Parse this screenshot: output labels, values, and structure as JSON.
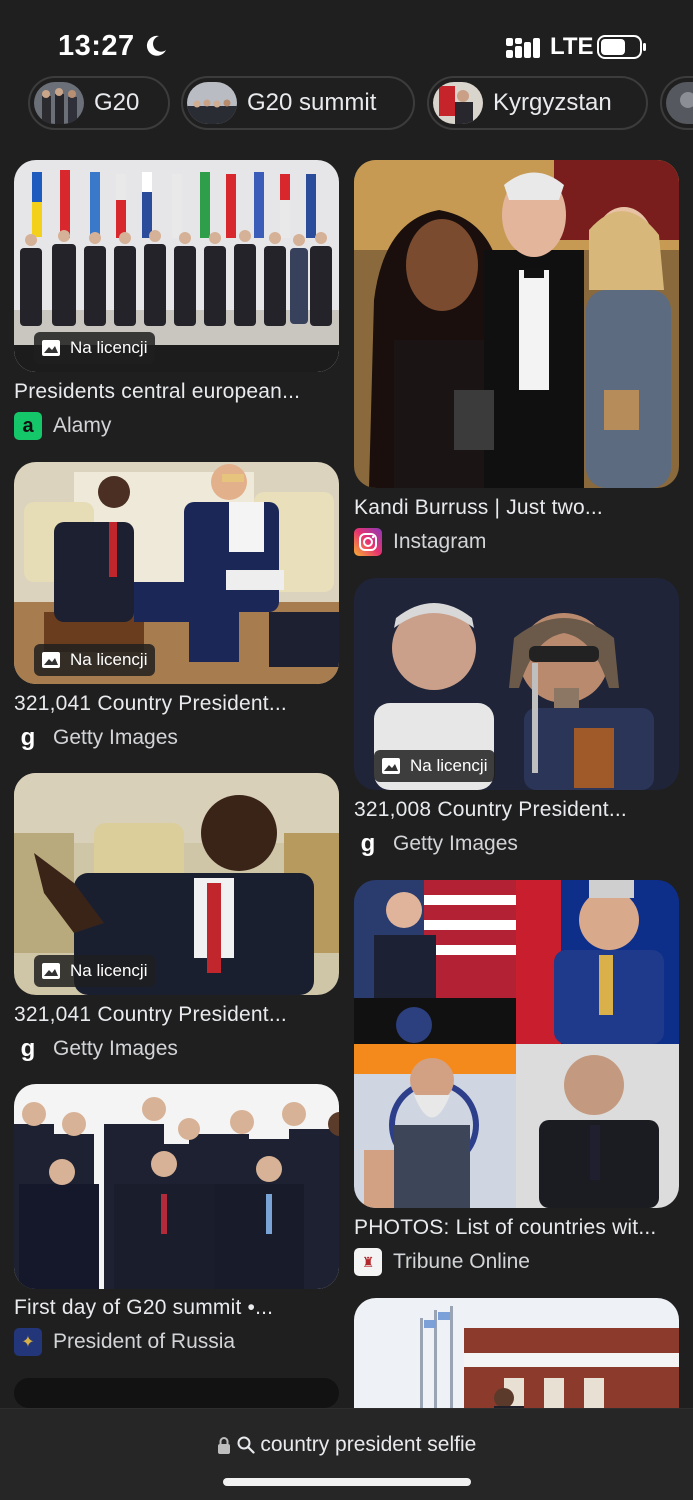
{
  "status_bar": {
    "time": "13:27",
    "network": "LTE"
  },
  "chips": [
    {
      "label": "G20"
    },
    {
      "label": "G20 summit"
    },
    {
      "label": "Kyrgyzstan"
    }
  ],
  "results_left": [
    {
      "title": "Presidents central european...",
      "source": "Alamy",
      "badge": "Na licencji"
    },
    {
      "title": "321,041 Country President...",
      "source": "Getty Images",
      "badge": "Na licencji"
    },
    {
      "title": "321,041 Country President...",
      "source": "Getty Images",
      "badge": "Na licencji"
    },
    {
      "title": "First day of G20 summit •...",
      "source": "President of Russia"
    }
  ],
  "results_right": [
    {
      "title": "Kandi Burruss | Just two...",
      "source": "Instagram"
    },
    {
      "title": "321,008 Country President...",
      "source": "Getty Images",
      "badge": "Na licencji"
    },
    {
      "title": "PHOTOS: List of countries wit...",
      "source": "Tribune Online"
    }
  ],
  "search": {
    "query": "country president selfie"
  },
  "icons": {
    "moon": "moon-icon",
    "signal": "signal-icon",
    "battery": "battery-icon",
    "license": "image-icon",
    "lock": "lock-icon",
    "search": "search-icon"
  },
  "colors": {
    "background": "#1f1f1f",
    "chip_border": "#3c3c3c",
    "text": "#e8eaed"
  }
}
